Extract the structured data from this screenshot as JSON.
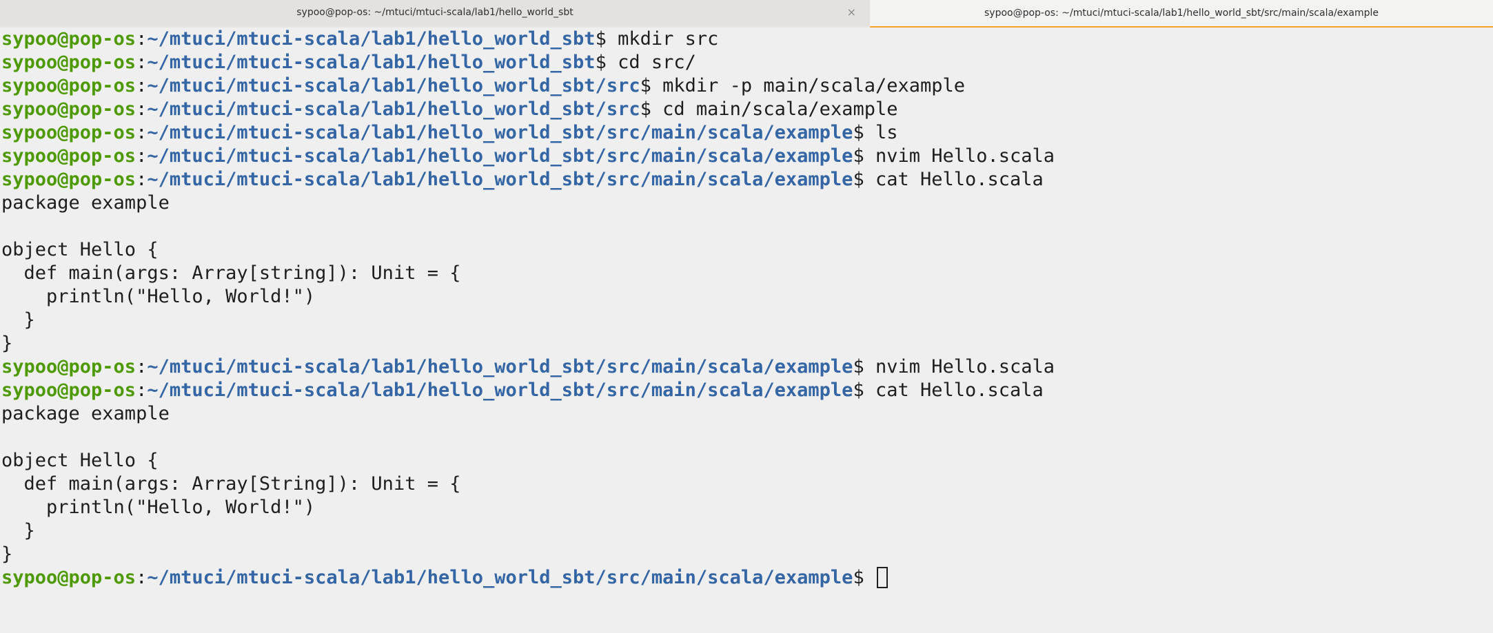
{
  "tabs": [
    {
      "title": "sypoo@pop-os: ~/mtuci/mtuci-scala/lab1/hello_world_sbt",
      "close": "×",
      "active": false
    },
    {
      "title": "sypoo@pop-os: ~/mtuci/mtuci-scala/lab1/hello_world_sbt/src/main/scala/example",
      "active": true
    }
  ],
  "prompt": {
    "user": "sypoo@pop-os",
    "colon": ":",
    "dollar": "$ "
  },
  "lines": [
    {
      "type": "prompt",
      "path": "~/mtuci/mtuci-scala/lab1/hello_world_sbt",
      "cmd": "mkdir src"
    },
    {
      "type": "prompt",
      "path": "~/mtuci/mtuci-scala/lab1/hello_world_sbt",
      "cmd": "cd src/"
    },
    {
      "type": "prompt",
      "path": "~/mtuci/mtuci-scala/lab1/hello_world_sbt/src",
      "cmd": "mkdir -p main/scala/example"
    },
    {
      "type": "prompt",
      "path": "~/mtuci/mtuci-scala/lab1/hello_world_sbt/src",
      "cmd": "cd main/scala/example"
    },
    {
      "type": "prompt",
      "path": "~/mtuci/mtuci-scala/lab1/hello_world_sbt/src/main/scala/example",
      "cmd": "ls"
    },
    {
      "type": "prompt",
      "path": "~/mtuci/mtuci-scala/lab1/hello_world_sbt/src/main/scala/example",
      "cmd": "nvim Hello.scala"
    },
    {
      "type": "prompt",
      "path": "~/mtuci/mtuci-scala/lab1/hello_world_sbt/src/main/scala/example",
      "cmd": "cat Hello.scala"
    },
    {
      "type": "output",
      "text": "package example"
    },
    {
      "type": "output",
      "text": ""
    },
    {
      "type": "output",
      "text": "object Hello {"
    },
    {
      "type": "output",
      "text": "  def main(args: Array[string]): Unit = {"
    },
    {
      "type": "output",
      "text": "    println(\"Hello, World!\")"
    },
    {
      "type": "output",
      "text": "  }"
    },
    {
      "type": "output",
      "text": "}"
    },
    {
      "type": "prompt",
      "path": "~/mtuci/mtuci-scala/lab1/hello_world_sbt/src/main/scala/example",
      "cmd": "nvim Hello.scala"
    },
    {
      "type": "prompt",
      "path": "~/mtuci/mtuci-scala/lab1/hello_world_sbt/src/main/scala/example",
      "cmd": "cat Hello.scala"
    },
    {
      "type": "output",
      "text": "package example"
    },
    {
      "type": "output",
      "text": ""
    },
    {
      "type": "output",
      "text": "object Hello {"
    },
    {
      "type": "output",
      "text": "  def main(args: Array[String]): Unit = {"
    },
    {
      "type": "output",
      "text": "    println(\"Hello, World!\")"
    },
    {
      "type": "output",
      "text": "  }"
    },
    {
      "type": "output",
      "text": "}"
    },
    {
      "type": "prompt",
      "path": "~/mtuci/mtuci-scala/lab1/hello_world_sbt/src/main/scala/example",
      "cmd": "",
      "cursor": true
    }
  ],
  "colors": {
    "user": "#4e9a06",
    "path": "#3465a4",
    "active_tab_accent": "#f6a42a",
    "background": "#efefef"
  }
}
